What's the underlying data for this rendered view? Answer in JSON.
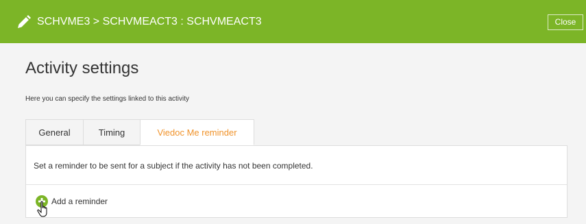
{
  "header": {
    "title": "SCHVME3 > SCHVMEACT3 : SCHVMEACT3",
    "close_label": "Close",
    "icon": "pencil-icon",
    "color": "#7cb527"
  },
  "page": {
    "title": "Activity settings",
    "subtitle": "Here you can specify the settings linked to this activity"
  },
  "tabs": [
    {
      "label": "General",
      "active": false
    },
    {
      "label": "Timing",
      "active": false
    },
    {
      "label": "Viedoc Me reminder",
      "active": true
    }
  ],
  "reminder": {
    "description": "Set a reminder to be sent for a subject if the activity has not been completed.",
    "add_label": "Add a reminder",
    "add_icon": "plus-circle-icon"
  },
  "colors": {
    "accent": "#f0932b",
    "add_icon": "#7cb527"
  }
}
